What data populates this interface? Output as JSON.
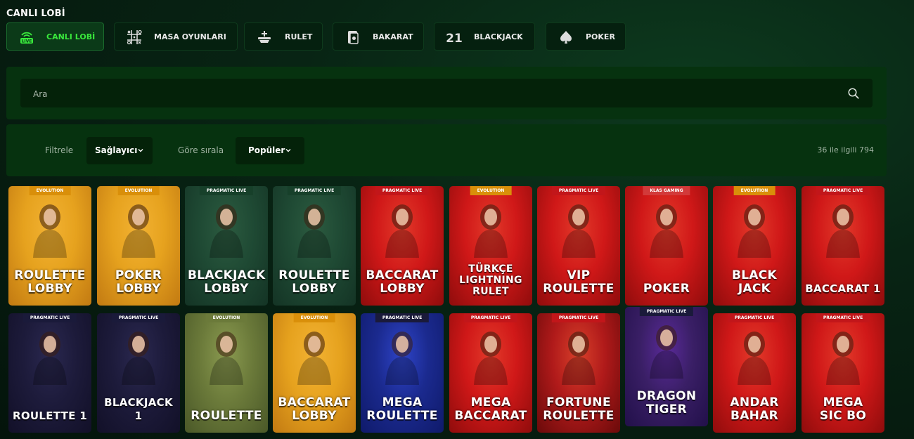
{
  "page_title": "CANLI LOBİ",
  "categories": [
    {
      "label": "CANLI LOBİ",
      "icon": "live-icon",
      "active": true
    },
    {
      "label": "MASA OYUNLARI",
      "icon": "tictactoe-icon",
      "active": false
    },
    {
      "label": "RULET",
      "icon": "roulette-icon",
      "active": false
    },
    {
      "label": "BAKARAT",
      "icon": "cards-icon",
      "active": false
    },
    {
      "label": "BLACKJACK",
      "icon": "number-21-icon",
      "active": false
    },
    {
      "label": "POKER",
      "icon": "spade-icon",
      "active": false
    }
  ],
  "search": {
    "placeholder": "Ara"
  },
  "filters": {
    "filter_label": "Filtrele",
    "provider_value": "Sağlayıcı",
    "sort_label": "Göre sırala",
    "sort_value": "Popüler",
    "count_text": "36 ile ilgili 794"
  },
  "games": [
    {
      "title": "ROULETTE\nLOBBY",
      "provider": "EVOLUTION",
      "theme": "gold"
    },
    {
      "title": "POKER\nLOBBY",
      "provider": "EVOLUTION",
      "theme": "gold"
    },
    {
      "title": "BLACKJACK\nLOBBY",
      "provider": "PRAGMATIC LIVE",
      "theme": "green"
    },
    {
      "title": "ROULETTE\nLOBBY",
      "provider": "PRAGMATIC LIVE",
      "theme": "green"
    },
    {
      "title": "BACCARAT\nLOBBY",
      "provider": "PRAGMATIC LIVE",
      "theme": "red"
    },
    {
      "title": "TÜRKÇE\nLIGHTNING\nRULET",
      "provider": "EVOLUTION",
      "theme": "red"
    },
    {
      "title": "VIP\nROULETTE",
      "provider": "PRAGMATIC LIVE",
      "theme": "red"
    },
    {
      "title": "POKER",
      "provider": "KLAS GAMING",
      "theme": "red"
    },
    {
      "title": "BLACK\nJACK",
      "provider": "EVOLUTION",
      "theme": "red"
    },
    {
      "title": "BACCARAT 1",
      "provider": "PRAGMATIC LIVE",
      "theme": "red"
    },
    {
      "title": "ROULETTE 1",
      "provider": "PRAGMATIC LIVE",
      "theme": "navy"
    },
    {
      "title": "BLACKJACK 1",
      "provider": "PRAGMATIC LIVE",
      "theme": "navy"
    },
    {
      "title": "ROULETTE",
      "provider": "EVOLUTION",
      "theme": "olive"
    },
    {
      "title": "BACCARAT\nLOBBY",
      "provider": "EVOLUTION",
      "theme": "gold"
    },
    {
      "title": "MEGA\nROULETTE",
      "provider": "PRAGMATIC LIVE",
      "theme": "blue"
    },
    {
      "title": "MEGA\nBACCARAT",
      "provider": "PRAGMATIC LIVE",
      "theme": "red"
    },
    {
      "title": "FORTUNE\nROULETTE",
      "provider": "PRAGMATIC LIVE",
      "theme": "crimson"
    },
    {
      "title": "DRAGON\nTIGER",
      "provider": "PRAGMATIC LIVE",
      "theme": "purple"
    },
    {
      "title": "ANDAR\nBAHAR",
      "provider": "PRAGMATIC LIVE",
      "theme": "red"
    },
    {
      "title": "MEGA\nSIC BO",
      "provider": "PRAGMATIC LIVE",
      "theme": "red"
    }
  ],
  "colors": {
    "accent": "#39e83c",
    "panel": "#06320f",
    "gold": "#e6a21e",
    "green": "#1f4a34",
    "red": "#d01818",
    "navy": "#1d1b3b",
    "olive": "#6b7a3a",
    "blue": "#1b2a8f",
    "purple": "#3a1f66",
    "crimson": "#b01a1a"
  }
}
